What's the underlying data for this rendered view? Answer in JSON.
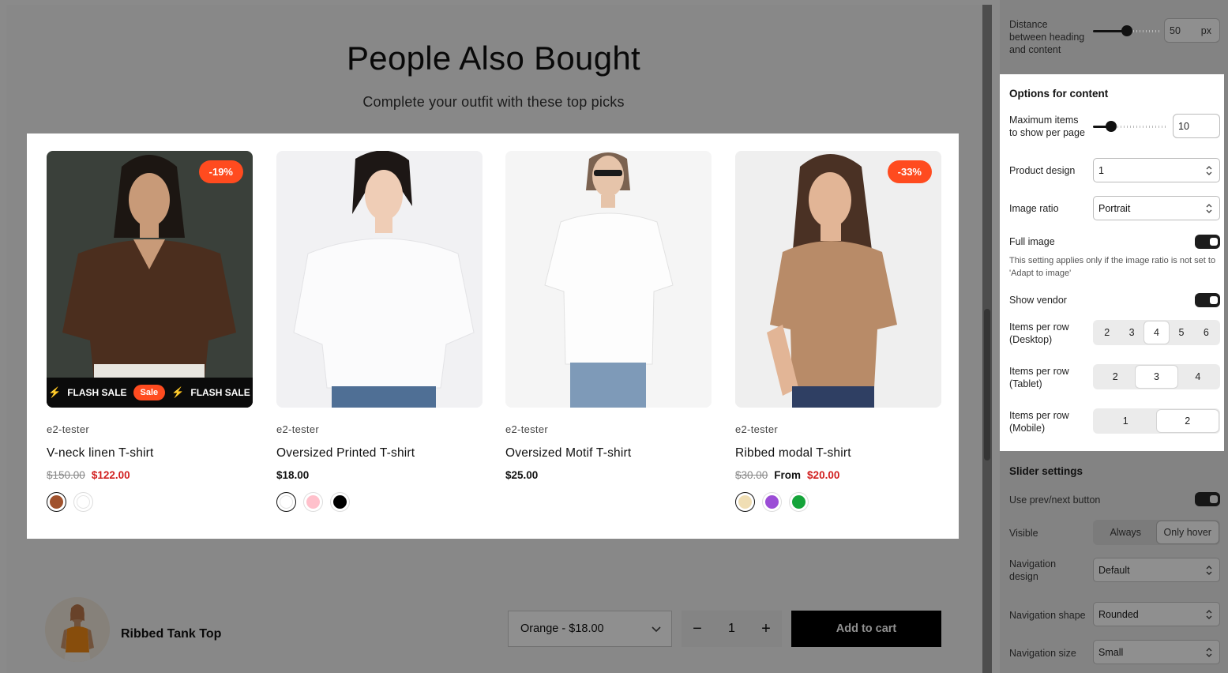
{
  "section": {
    "title": "People Also Bought",
    "subtitle": "Complete your outfit with these top picks"
  },
  "products": [
    {
      "vendor": "e2-tester",
      "name": "V-neck linen T-shirt",
      "price_old": "$150.00",
      "price": "$122.00",
      "badge": "-19%",
      "flash_label": "FLASH SALE",
      "sale_pill": "Sale",
      "swatches": [
        "#a0522d",
        "#ffffff"
      ]
    },
    {
      "vendor": "e2-tester",
      "name": "Oversized Printed T-shirt",
      "price": "$18.00",
      "swatches": [
        "#ffffff",
        "#ffc0cb",
        "#000000"
      ]
    },
    {
      "vendor": "e2-tester",
      "name": "Oversized Motif T-shirt",
      "price": "$25.00",
      "swatches": []
    },
    {
      "vendor": "e2-tester",
      "name": "Ribbed modal T-shirt",
      "price_old": "$30.00",
      "price_prefix": "From",
      "price": "$20.00",
      "badge": "-33%",
      "swatches": [
        "#f0deb4",
        "#9b4dd6",
        "#15a43a"
      ]
    }
  ],
  "sticky_bar": {
    "product_name": "Ribbed Tank Top",
    "variant": "Orange - $18.00",
    "quantity": "1",
    "add_to_cart": "Add to cart",
    "minus": "−",
    "plus": "+"
  },
  "panel": {
    "distance": {
      "label_line1": "Distance",
      "label_line2": "between heading",
      "label_line3": "and content",
      "value": "50",
      "unit": "px",
      "slider_fraction": 0.5
    },
    "content_options": {
      "title": "Options for content",
      "max_items": {
        "label_line1": "Maximum items",
        "label_line2": "to show per page",
        "value": "10",
        "slider_fraction": 0.25
      },
      "product_design": {
        "label": "Product design",
        "value": "1"
      },
      "image_ratio": {
        "label": "Image ratio",
        "value": "Portrait"
      },
      "full_image": {
        "label": "Full image",
        "on": true,
        "help": "This setting applies only if the image ratio is not set to 'Adapt to image'"
      },
      "show_vendor": {
        "label": "Show vendor",
        "on": true
      },
      "per_row_desktop": {
        "label_line1": "Items per row",
        "label_line2": "(Desktop)",
        "options": [
          "2",
          "3",
          "4",
          "5",
          "6"
        ],
        "selected": "4"
      },
      "per_row_tablet": {
        "label_line1": "Items per row",
        "label_line2": "(Tablet)",
        "options": [
          "2",
          "3",
          "4"
        ],
        "selected": "3"
      },
      "per_row_mobile": {
        "label_line1": "Items per row",
        "label_line2": "(Mobile)",
        "options": [
          "1",
          "2"
        ],
        "selected": "2"
      }
    },
    "slider_settings": {
      "title": "Slider settings",
      "prev_next": {
        "label": "Use prev/next button",
        "on": true
      },
      "visible": {
        "label": "Visible",
        "options": [
          "Always",
          "Only hover"
        ],
        "selected": "Only hover"
      },
      "nav_design": {
        "label_line1": "Navigation",
        "label_line2": "design",
        "value": "Default"
      },
      "nav_shape": {
        "label": "Navigation shape",
        "value": "Rounded"
      },
      "nav_size": {
        "label": "Navigation size",
        "value": "Small"
      }
    }
  }
}
